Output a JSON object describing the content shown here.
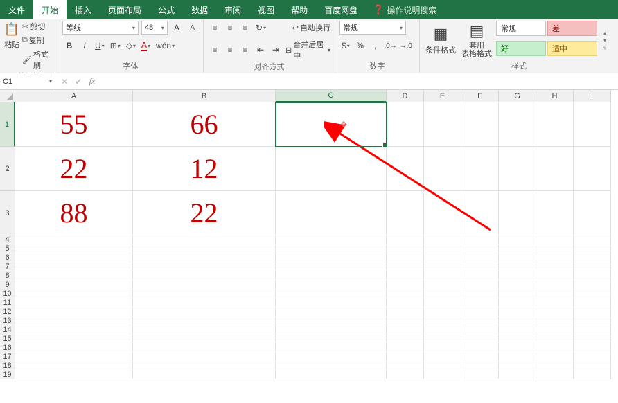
{
  "tabs": {
    "file": "文件",
    "home": "开始",
    "insert": "插入",
    "layout": "页面布局",
    "formula": "公式",
    "data": "数据",
    "review": "审阅",
    "view": "视图",
    "help": "帮助",
    "baidu": "百度网盘",
    "tellme": "操作说明搜索"
  },
  "clipboard": {
    "group": "剪贴板",
    "paste": "粘贴",
    "cut": "剪切",
    "copy": "复制",
    "painter": "格式刷"
  },
  "font": {
    "group": "字体",
    "name": "等线",
    "size": "48"
  },
  "align": {
    "group": "对齐方式",
    "wrap": "自动换行",
    "merge": "合并后居中"
  },
  "number": {
    "group": "数字",
    "format": "常规"
  },
  "styles": {
    "group": "样式",
    "cond": "条件格式",
    "table": "套用\n表格格式",
    "normal": "常规",
    "bad": "差",
    "good": "好",
    "neutral": "适中"
  },
  "namebox": "C1",
  "cols": [
    "A",
    "B",
    "C",
    "D",
    "E",
    "F",
    "G",
    "H",
    "I"
  ],
  "dataCells": {
    "A1": "55",
    "B1": "66",
    "A2": "22",
    "B2": "12",
    "A3": "88",
    "B3": "22"
  }
}
